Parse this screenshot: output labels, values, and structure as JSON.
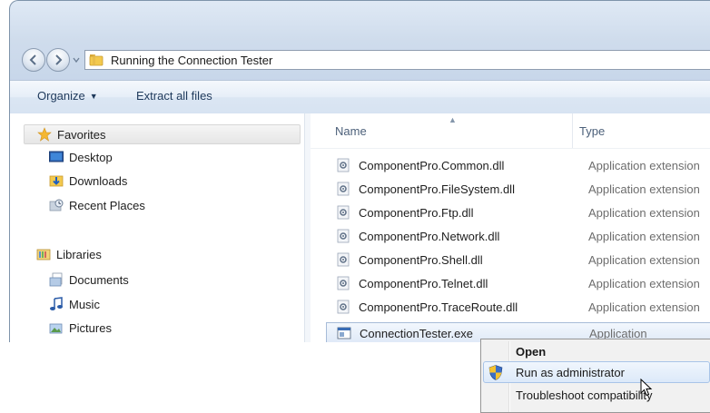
{
  "address": {
    "path": "Running the Connection Tester"
  },
  "toolbar": {
    "organize_label": "Organize",
    "extract_label": "Extract all files"
  },
  "nav": {
    "favorites": "Favorites",
    "desktop": "Desktop",
    "downloads": "Downloads",
    "recent": "Recent Places",
    "libraries": "Libraries",
    "documents": "Documents",
    "music": "Music",
    "pictures": "Pictures"
  },
  "columns": {
    "name": "Name",
    "type": "Type"
  },
  "files": [
    {
      "name": "ComponentPro.Common.dll",
      "type": "Application extension"
    },
    {
      "name": "ComponentPro.FileSystem.dll",
      "type": "Application extension"
    },
    {
      "name": "ComponentPro.Ftp.dll",
      "type": "Application extension"
    },
    {
      "name": "ComponentPro.Network.dll",
      "type": "Application extension"
    },
    {
      "name": "ComponentPro.Shell.dll",
      "type": "Application extension"
    },
    {
      "name": "ComponentPro.Telnet.dll",
      "type": "Application extension"
    },
    {
      "name": "ComponentPro.TraceRoute.dll",
      "type": "Application extension"
    },
    {
      "name": "ConnectionTester.exe",
      "type": "Application"
    }
  ],
  "context_menu": {
    "open": "Open",
    "run_as_admin": "Run as administrator",
    "troubleshoot": "Troubleshoot compatibility"
  },
  "icons": {
    "back": "back-arrow-icon",
    "forward": "forward-arrow-icon",
    "folder": "folder-icon",
    "star": "star-icon",
    "dll": "dll-file-icon",
    "exe": "exe-file-icon",
    "shield": "uac-shield-icon"
  },
  "colors": {
    "toolbar_text": "#1e395b",
    "selection_border": "#a7bcd8",
    "header_text": "#4c607a"
  }
}
